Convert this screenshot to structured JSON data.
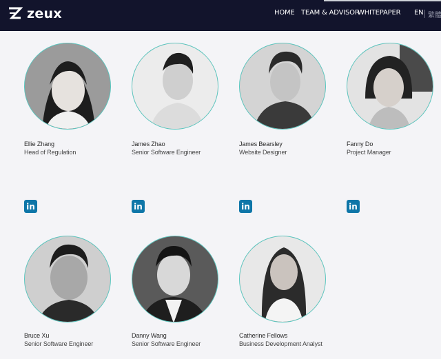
{
  "brand": {
    "name": "zeux"
  },
  "nav": {
    "items": [
      "HOME",
      "TEAM & ADVISOR",
      "WHITEPAPER"
    ],
    "language": "EN",
    "language_alt": "繁體"
  },
  "team": [
    {
      "name": "Ellie Zhang",
      "role": "Head of Regulation",
      "icon": "linkedin-icon"
    },
    {
      "name": "James Zhao",
      "role": "Senior Software Engineer",
      "icon": "linkedin-icon"
    },
    {
      "name": "James Bearsley",
      "role": "Website Designer",
      "icon": "linkedin-icon"
    },
    {
      "name": "Fanny Do",
      "role": "Project Manager",
      "icon": "linkedin-icon"
    },
    {
      "name": "Bruce Xu",
      "role": "Senior Software Engineer"
    },
    {
      "name": "Danny Wang",
      "role": "Senior Software Engineer"
    },
    {
      "name": "Catherine Fellows",
      "role": "Business Development Analyst"
    }
  ],
  "linkedin_glyph": "in",
  "colors": {
    "header_bg": "#12142c",
    "page_bg": "#f4f4f7",
    "avatar_ring": "#5ac8c0",
    "linkedin_blue": "#0e76a8"
  }
}
